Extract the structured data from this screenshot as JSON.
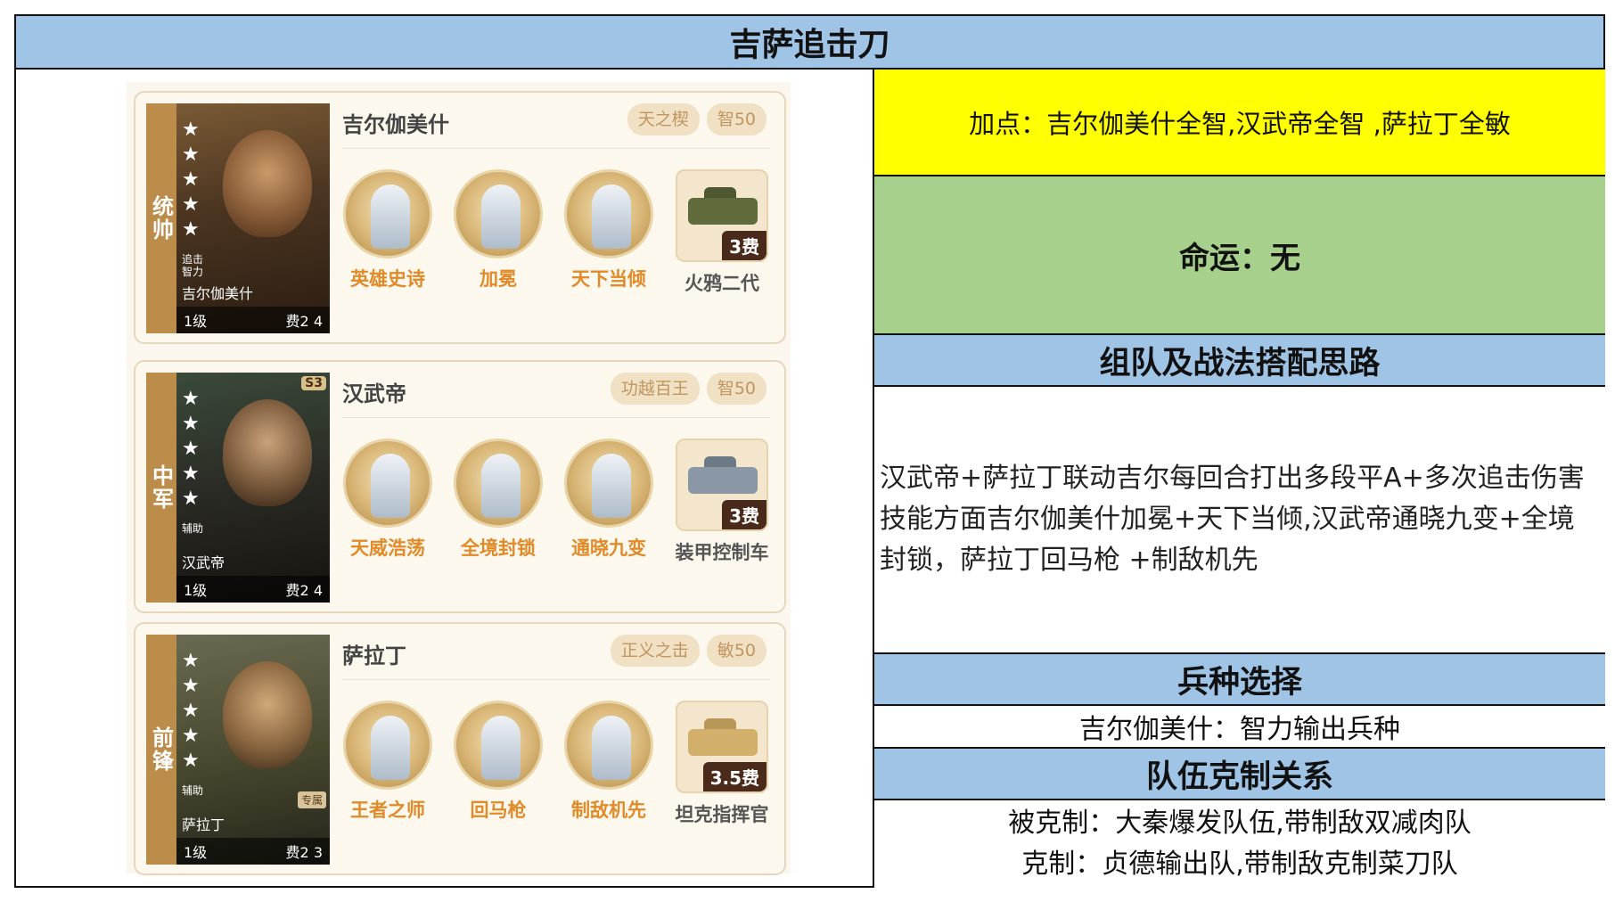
{
  "title": "吉萨追击刀",
  "heroes": [
    {
      "rank": "统帅",
      "name": "吉尔伽美什",
      "tag": "天之楔",
      "stat": "智50",
      "portrait": {
        "stars": 5,
        "tag_lines": "追击\n智力",
        "hero_name": "吉尔伽美什",
        "level": "1级",
        "cost": "费2 4"
      },
      "skills": [
        "英雄史诗",
        "加冕",
        "天下当倾"
      ],
      "vehicle": {
        "name": "火鸦二代",
        "cost": "3费"
      }
    },
    {
      "rank": "中军",
      "name": "汉武帝",
      "tag": "功越百王",
      "stat": "智50",
      "portrait": {
        "stars": 5,
        "tag_lines": "辅助",
        "hero_name": "汉武帝",
        "level": "1级",
        "cost": "费2 4",
        "badge": "S3"
      },
      "skills": [
        "天威浩荡",
        "全境封锁",
        "通晓九变"
      ],
      "vehicle": {
        "name": "装甲控制车",
        "cost": "3费"
      }
    },
    {
      "rank": "前锋",
      "name": "萨拉丁",
      "tag": "正义之击",
      "stat": "敏50",
      "portrait": {
        "stars": 5,
        "tag_lines": "辅助",
        "hero_name": "萨拉丁",
        "level": "1级",
        "cost": "费2 3",
        "special": "专属"
      },
      "skills": [
        "王者之师",
        "回马枪",
        "制敌机先"
      ],
      "vehicle": {
        "name": "坦克指挥官",
        "cost": "3.5费"
      }
    }
  ],
  "right": {
    "points": "加点：吉尔伽美什全智,汉武帝全智 ,萨拉丁全敏",
    "fate": "命运：无",
    "team_heading": "组队及战法搭配思路",
    "team_idea_1": "汉武帝+萨拉丁联动吉尔每回合打出多段平A+多次追击伤害",
    "team_idea_2": "技能方面吉尔伽美什加冕+天下当倾,汉武帝通晓九变+全境封锁，萨拉丁回马枪 +制敌机先",
    "troop_heading": "兵种选择",
    "troop": "吉尔伽美什：智力输出兵种",
    "counter_heading": "队伍克制关系",
    "countered_by": "被克制：大秦爆发队伍,带制敌双减肉队",
    "counters": "克制：贞德输出队,带制敌克制菜刀队"
  }
}
